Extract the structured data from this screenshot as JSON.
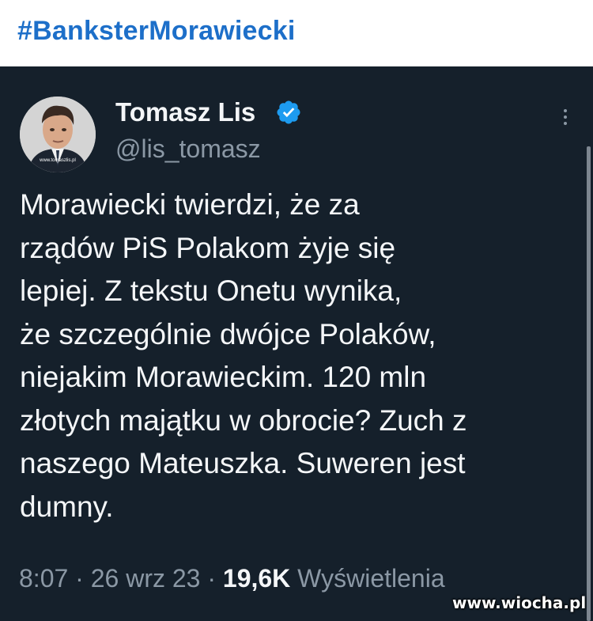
{
  "header": {
    "hashtag": "#BanksterMorawiecki"
  },
  "tweet": {
    "author_name": "Tomasz Lis",
    "author_handle": "@lis_tomasz",
    "avatar_watermark": "www.tomaszlis.pl",
    "verified_icon": "verified-badge-icon",
    "more_icon": "vertical-ellipsis-icon",
    "text": "Morawiecki twierdzi, że za\nrządów PiS Polakom żyje się\nlepiej. Z tekstu Onetu wynika,\nże szczególnie dwójce Polaków,\nniejakim Morawieckim. 120 mln\nzłotych majątku w obrocie? Zuch z\nnaszego Mateuszka. Suweren jest\ndumny.",
    "time": "8:07",
    "sep1": " · ",
    "date": "26 wrz 23",
    "sep2": " · ",
    "views_count": "19,6K",
    "views_label": " Wyświetlenia"
  },
  "watermark": "www.wiocha.pl",
  "colors": {
    "background": "#15202b",
    "text": "#f4f6f8",
    "secondary": "#8b98a5",
    "hashtag": "#1d6fc9",
    "verified": "#1d9bf0"
  }
}
